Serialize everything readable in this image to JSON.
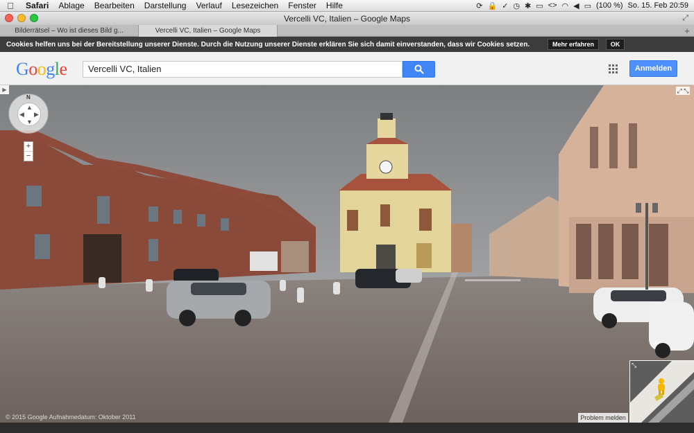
{
  "menubar": {
    "app": "Safari",
    "items": [
      "Ablage",
      "Bearbeiten",
      "Darstellung",
      "Verlauf",
      "Lesezeichen",
      "Fenster",
      "Hilfe"
    ],
    "battery": "(100 %)",
    "clock": "So. 15. Feb  20:59"
  },
  "window": {
    "title": "Vercelli VC, Italien – Google Maps"
  },
  "tabs": [
    {
      "label": "Bilderrätsel – Wo ist dieses Bild g...",
      "active": false
    },
    {
      "label": "Vercelli VC, Italien – Google Maps",
      "active": true
    }
  ],
  "cookie": {
    "text": "Cookies helfen uns bei der Bereitstellung unserer Dienste. Durch die Nutzung unserer Dienste erklären Sie sich damit einverstanden, dass wir Cookies setzen.",
    "more_label": "Mehr erfahren",
    "ok_label": "OK"
  },
  "header": {
    "logo": "Google",
    "search_value": "Vercelli VC, Italien",
    "signin_label": "Anmelden"
  },
  "streetview": {
    "compass_label": "N",
    "zoom_in": "+",
    "zoom_out": "−",
    "attribution": "© 2015 Google    Aufnahmedatum: Oktober 2011",
    "report_label": "Problem melden"
  },
  "colors": {
    "accent": "#4d90fe",
    "cookie_bg": "#3c3c3c"
  }
}
